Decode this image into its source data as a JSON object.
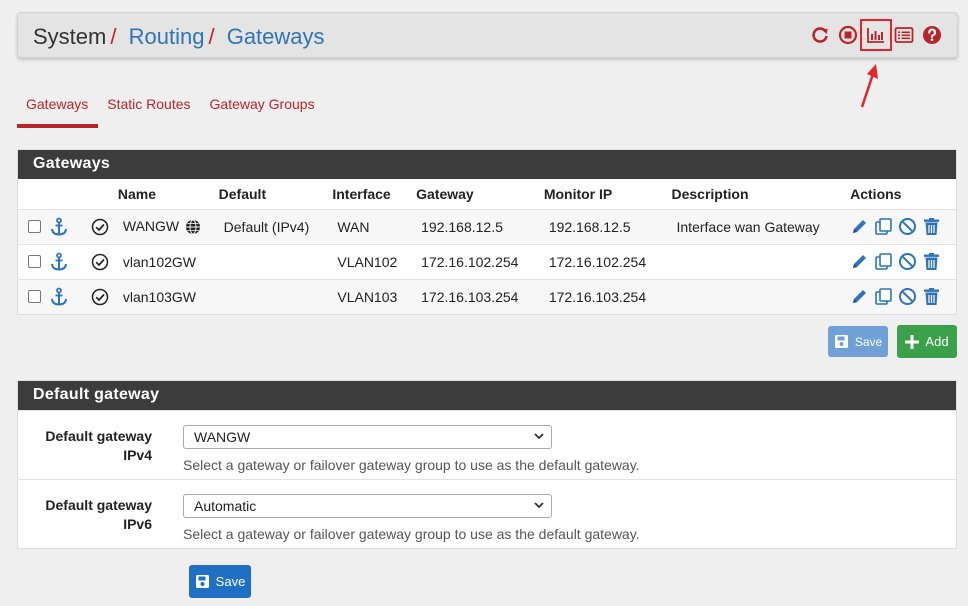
{
  "breadcrumb": {
    "system": "System",
    "sep": "/",
    "routing": "Routing",
    "gateways": "Gateways"
  },
  "header_icons": [
    "reload-icon",
    "stop-icon",
    "chart-icon",
    "log-icon",
    "help-icon"
  ],
  "tabs": [
    {
      "label": "Gateways",
      "active": true
    },
    {
      "label": "Static Routes",
      "active": false
    },
    {
      "label": "Gateway Groups",
      "active": false
    }
  ],
  "gateways_panel": {
    "title": "Gateways",
    "columns": [
      "Name",
      "Default",
      "Interface",
      "Gateway",
      "Monitor IP",
      "Description",
      "Actions"
    ],
    "rows": [
      {
        "name": "WANGW",
        "default": "Default (IPv4)",
        "interface": "WAN",
        "gateway": "192.168.12.5",
        "monitor_ip": "192.168.12.5",
        "description": "Interface wan Gateway"
      },
      {
        "name": "vlan102GW",
        "default": "",
        "interface": "VLAN102",
        "gateway": "172.16.102.254",
        "monitor_ip": "172.16.102.254",
        "description": ""
      },
      {
        "name": "vlan103GW",
        "default": "",
        "interface": "VLAN103",
        "gateway": "172.16.103.254",
        "monitor_ip": "172.16.103.254",
        "description": ""
      }
    ]
  },
  "buttons": {
    "save": "Save",
    "add": "Add"
  },
  "default_gateway_panel": {
    "title": "Default gateway",
    "ipv4": {
      "label_line1": "Default gateway",
      "label_line2": "IPv4",
      "value": "WANGW",
      "help": "Select a gateway or failover gateway group to use as the default gateway."
    },
    "ipv6": {
      "label_line1": "Default gateway",
      "label_line2": "IPv6",
      "value": "Automatic",
      "help": "Select a gateway or failover gateway group to use as the default gateway."
    }
  },
  "colors": {
    "accent_red": "#b9252b",
    "link_blue": "#2f74b6",
    "panel_head": "#3c3c3c",
    "add_green": "#3ba04a",
    "save_blue": "#1f6fc5"
  }
}
